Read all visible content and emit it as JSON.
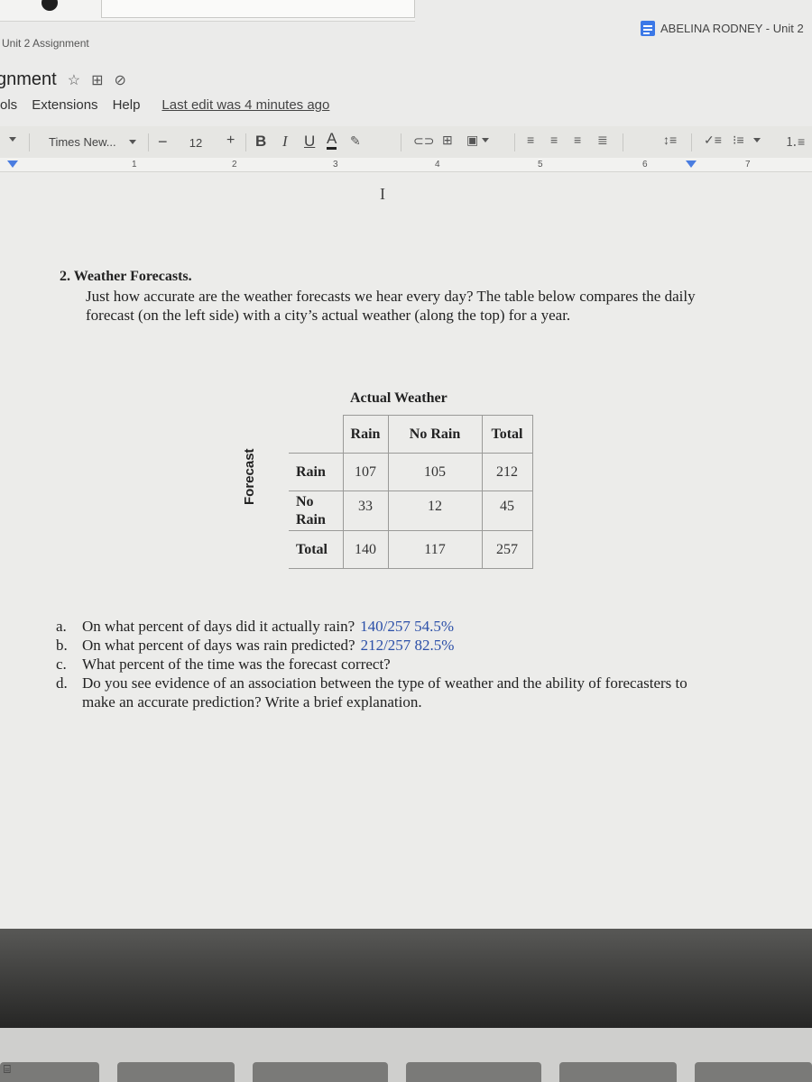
{
  "window": {
    "title": "Unit 2 Assignment",
    "account": "ABELINA RODNEY - Unit 2"
  },
  "doc_header": {
    "title_fragment": "gnment",
    "star_icon": "star-icon",
    "move_icon": "move-to-folder-icon",
    "cloud_icon": "cloud-status-icon"
  },
  "menu": {
    "items": [
      "ols",
      "Extensions",
      "Help"
    ],
    "last_edit": "Last edit was 4 minutes ago"
  },
  "toolbar": {
    "font_name": "Times New...",
    "font_size": "12",
    "decrease_label": "−",
    "increase_label": "+",
    "bold": "B",
    "italic": "I",
    "underline": "U",
    "text_color": "A",
    "highlight_icon": "pencil-icon",
    "link_icon": "link-icon",
    "comment_icon": "add-comment-icon",
    "image_icon": "insert-image-icon",
    "align_icons": [
      "align-left-icon",
      "align-center-icon",
      "align-right-icon",
      "align-justify-icon"
    ],
    "line_spacing_icon": "line-spacing-icon",
    "checklist_icon": "checklist-icon",
    "bullet_icon": "bulleted-list-icon",
    "numbered_icon": "numbered-list-icon"
  },
  "ruler": {
    "numbers": [
      "1",
      "2",
      "3",
      "4",
      "5",
      "6",
      "7"
    ]
  },
  "content": {
    "question_title": "2.  Weather Forecasts.",
    "question_body": "Just how accurate are the weather forecasts we hear every day? The table below compares the daily forecast (on the left side) with a city’s actual weather (along the top) for a year.",
    "table": {
      "caption": "Actual Weather",
      "side_label": "Forecast",
      "col_headers": [
        "Rain",
        "No Rain",
        "Total"
      ],
      "rows": [
        {
          "label": "Rain",
          "values": [
            "107",
            "105",
            "212"
          ]
        },
        {
          "label": "No Rain",
          "values": [
            "33",
            "12",
            "45"
          ]
        },
        {
          "label": "Total",
          "values": [
            "140",
            "117",
            "257"
          ]
        }
      ]
    },
    "questions": [
      {
        "label": "a.",
        "text": "On what percent of days did it actually rain?",
        "answer": "140/257  54.5%"
      },
      {
        "label": "b.",
        "text": "On what percent of days was rain predicted?",
        "answer": "212/257  82.5%"
      },
      {
        "label": "c.",
        "text": "What percent of the time was the forecast correct?",
        "answer": ""
      },
      {
        "label": "d.",
        "text": "Do you see evidence of an association between the type of weather and the ability of forecasters to make an accurate prediction? Write a brief explanation.",
        "answer": ""
      }
    ]
  },
  "colors": {
    "accent_blue": "#3b78e7",
    "answer_text": "#2b4fa8"
  }
}
